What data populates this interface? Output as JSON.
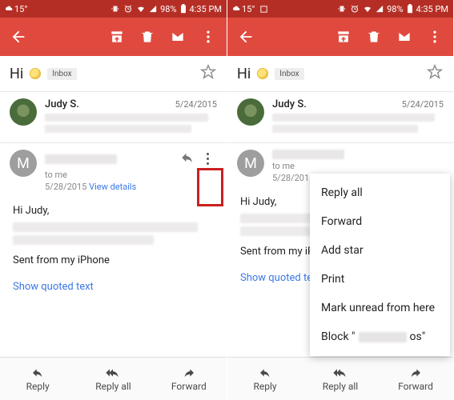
{
  "status": {
    "temp": "15°",
    "battery_pct": "98%",
    "time": "4:35 PM"
  },
  "subject": {
    "text": "Hi",
    "label": "Inbox"
  },
  "msg1": {
    "sender": "Judy S.",
    "date": "5/24/2015"
  },
  "msg2": {
    "sender_initial": "M",
    "to_line": "to me",
    "date": "5/28/2015",
    "view_details": "View details",
    "greeting": "Hi Judy,",
    "sent_from": "Sent from my iPhone",
    "sent_from_trunc": "Sent from my iPh",
    "show_quoted": "Show quoted text"
  },
  "bottombar": {
    "reply": "Reply",
    "reply_all": "Reply all",
    "forward": "Forward"
  },
  "popup": {
    "reply_all": "Reply all",
    "forward": "Forward",
    "add_star": "Add star",
    "print": "Print",
    "mark_unread": "Mark unread from here",
    "block_prefix": "Block \"",
    "block_suffix": "os\""
  }
}
